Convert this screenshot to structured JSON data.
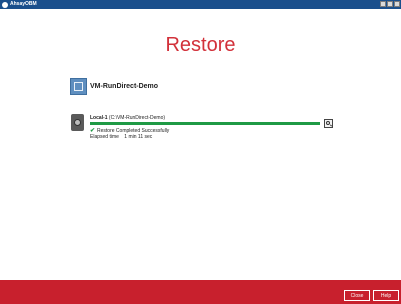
{
  "window": {
    "app_title": "AhsayOBM"
  },
  "page": {
    "title": "Restore"
  },
  "vm": {
    "name": "VM-RunDirect-Demo"
  },
  "destination": {
    "name": "Local-1",
    "path": "(C:\\VM-RunDirect-Demo)",
    "progress": 1.0,
    "status": "Restore Completed Successfully",
    "elapsed_label": "Elapsed time",
    "elapsed_value": "1 min 11 sec"
  },
  "footer": {
    "close_label": "Close",
    "help_label": "Help"
  },
  "colors": {
    "accent_red": "#c8202d",
    "progress_green": "#1f9a45",
    "titlebar_blue": "#1a4f8c"
  },
  "icons": [
    "app-icon",
    "vm-icon",
    "local-destination-icon",
    "search-icon",
    "check-icon"
  ]
}
